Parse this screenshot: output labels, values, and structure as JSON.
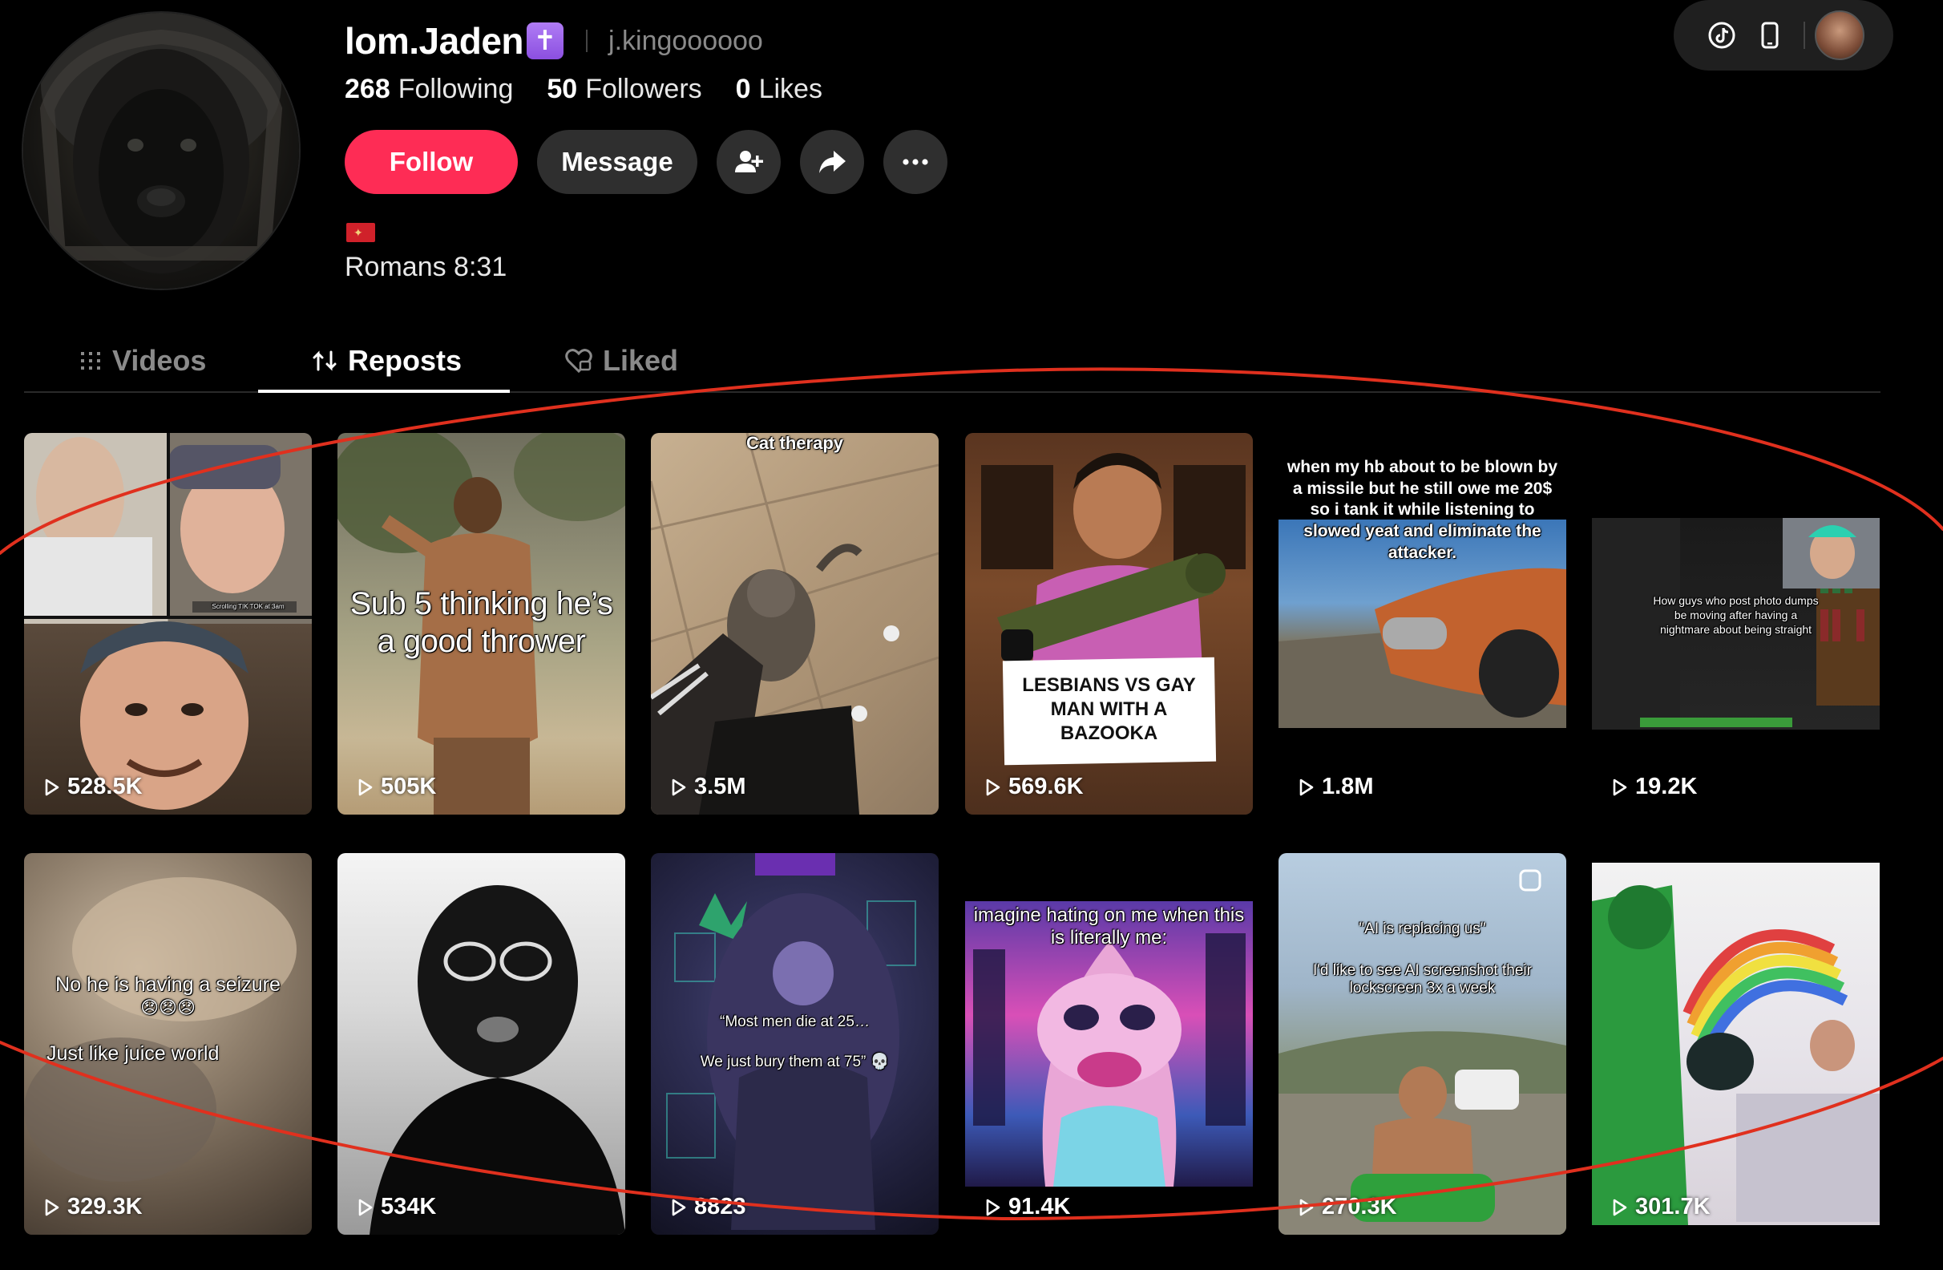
{
  "profile": {
    "username": "lom.Jaden",
    "badge_glyph": "✝",
    "handle": "j.kingoooooo",
    "stats": {
      "following_count": "268",
      "following_label": "Following",
      "followers_count": "50",
      "followers_label": "Followers",
      "likes_count": "0",
      "likes_label": "Likes"
    },
    "bio": "Romans 8:31",
    "flag_colors": [
      "#d0212a",
      "#f2d27a"
    ]
  },
  "actions": {
    "follow_label": "Follow",
    "message_label": "Message",
    "add_friend_icon": "add-user-icon",
    "share_icon": "share-icon",
    "more_icon": "more-icon"
  },
  "top_controls": {
    "icons": [
      "tiktok-icon",
      "phone-icon",
      "account-avatar"
    ]
  },
  "tabs": [
    {
      "label": "Videos",
      "icon": "grid-icon"
    },
    {
      "label": "Reposts",
      "icon": "repost-icon",
      "active": true
    },
    {
      "label": "Liked",
      "icon": "heart-lock-icon"
    }
  ],
  "videos": [
    {
      "views": "528.5K",
      "caption": "",
      "overlay": "Scrolling TIK TOK at 3am"
    },
    {
      "views": "505K",
      "caption": "Sub 5 thinking he’s a good thrower"
    },
    {
      "views": "3.5M",
      "caption": "Cat therapy"
    },
    {
      "views": "569.6K",
      "caption": "LESBIANS VS GAY MAN WITH A BAZOOKA"
    },
    {
      "views": "1.8M",
      "caption": "when my hb about to be blown by a missile but he still owe me 20$ so i tank it while listening to slowed yeat and eliminate the attacker."
    },
    {
      "views": "19.2K",
      "caption": "How guys who post photo dumps be moving after having a nightmare about being straight"
    },
    {
      "views": "329.3K",
      "caption": "No he is having a seizure",
      "caption2": "😞😞😞",
      "caption3": "Just like juice world"
    },
    {
      "views": "534K",
      "caption": ""
    },
    {
      "views": "8823",
      "caption": "“Most men die at 25…",
      "caption2": "We just bury them at 75” 💀"
    },
    {
      "views": "91.4K",
      "caption": "imagine hating on me when this is literally me:"
    },
    {
      "views": "270.3K",
      "caption": "\"AI is replacing us\"",
      "caption2": "I'd like to see AI screenshot their lockscreen 3x a week"
    },
    {
      "views": "301.7K",
      "caption": ""
    }
  ],
  "colors": {
    "accent": "#fe2c55",
    "background": "#000000",
    "button_dark": "#2f2f2f",
    "annotation": "#e0301e"
  }
}
